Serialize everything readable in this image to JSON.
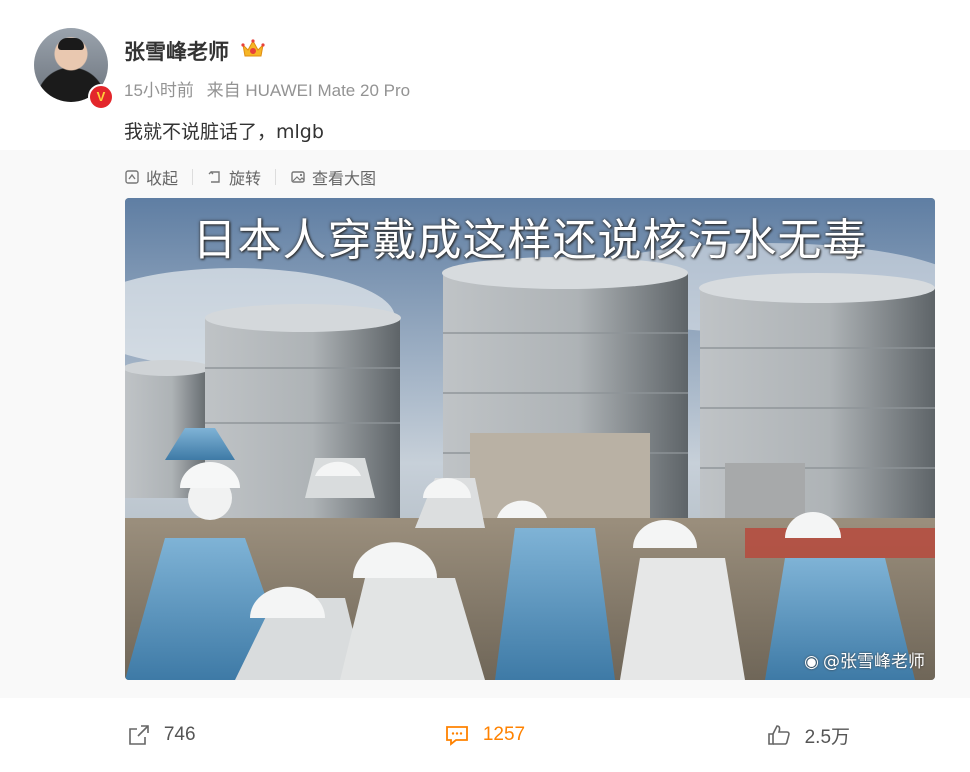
{
  "user": {
    "name": "张雪峰老师",
    "verified_badge": "V",
    "crown_icon": "crown-icon"
  },
  "meta": {
    "time": "15小时前",
    "source": "来自 HUAWEI Mate 20 Pro"
  },
  "post": {
    "text": "我就不说脏话了，mlgb"
  },
  "media_toolbar": {
    "collapse_label": "收起",
    "rotate_label": "旋转",
    "view_large_label": "查看大图"
  },
  "image": {
    "caption": "日本人穿戴成这样还说核污水无毒",
    "watermark": "@张雪峰老师"
  },
  "actions": {
    "share_count": "746",
    "comment_count": "1257",
    "like_count": "2.5万"
  },
  "colors": {
    "accent": "#ff8200",
    "vbadge": "#e3262b"
  }
}
